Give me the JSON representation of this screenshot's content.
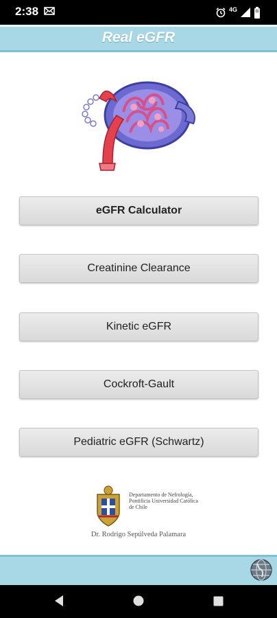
{
  "status_bar": {
    "time": "2:38",
    "left_icon": "mail-icon",
    "network": "4G",
    "right_icons": [
      "alarm-icon",
      "signal-icon",
      "battery-icon"
    ]
  },
  "header": {
    "title": "Real eGFR",
    "background_color": "#a8d8e6"
  },
  "illustration": {
    "icon": "kidney-nephron-icon"
  },
  "menu": {
    "buttons": [
      {
        "label": "eGFR Calculator"
      },
      {
        "label": "Creatinine Clearance"
      },
      {
        "label": "Kinetic eGFR"
      },
      {
        "label": "Cockroft-Gault"
      },
      {
        "label": "Pediatric eGFR (Schwartz)"
      }
    ]
  },
  "credits": {
    "institution": "Departamento de Nefrología, Pontificia Universidad Católica de Chile",
    "author": "Dr. Rodrigo Sepúlveda Palamara",
    "seal_icon": "university-seal-icon"
  },
  "footer": {
    "icon": "globe-icon"
  },
  "navigation": {
    "back_icon": "back-icon",
    "home_icon": "home-icon",
    "recents_icon": "recents-icon"
  }
}
